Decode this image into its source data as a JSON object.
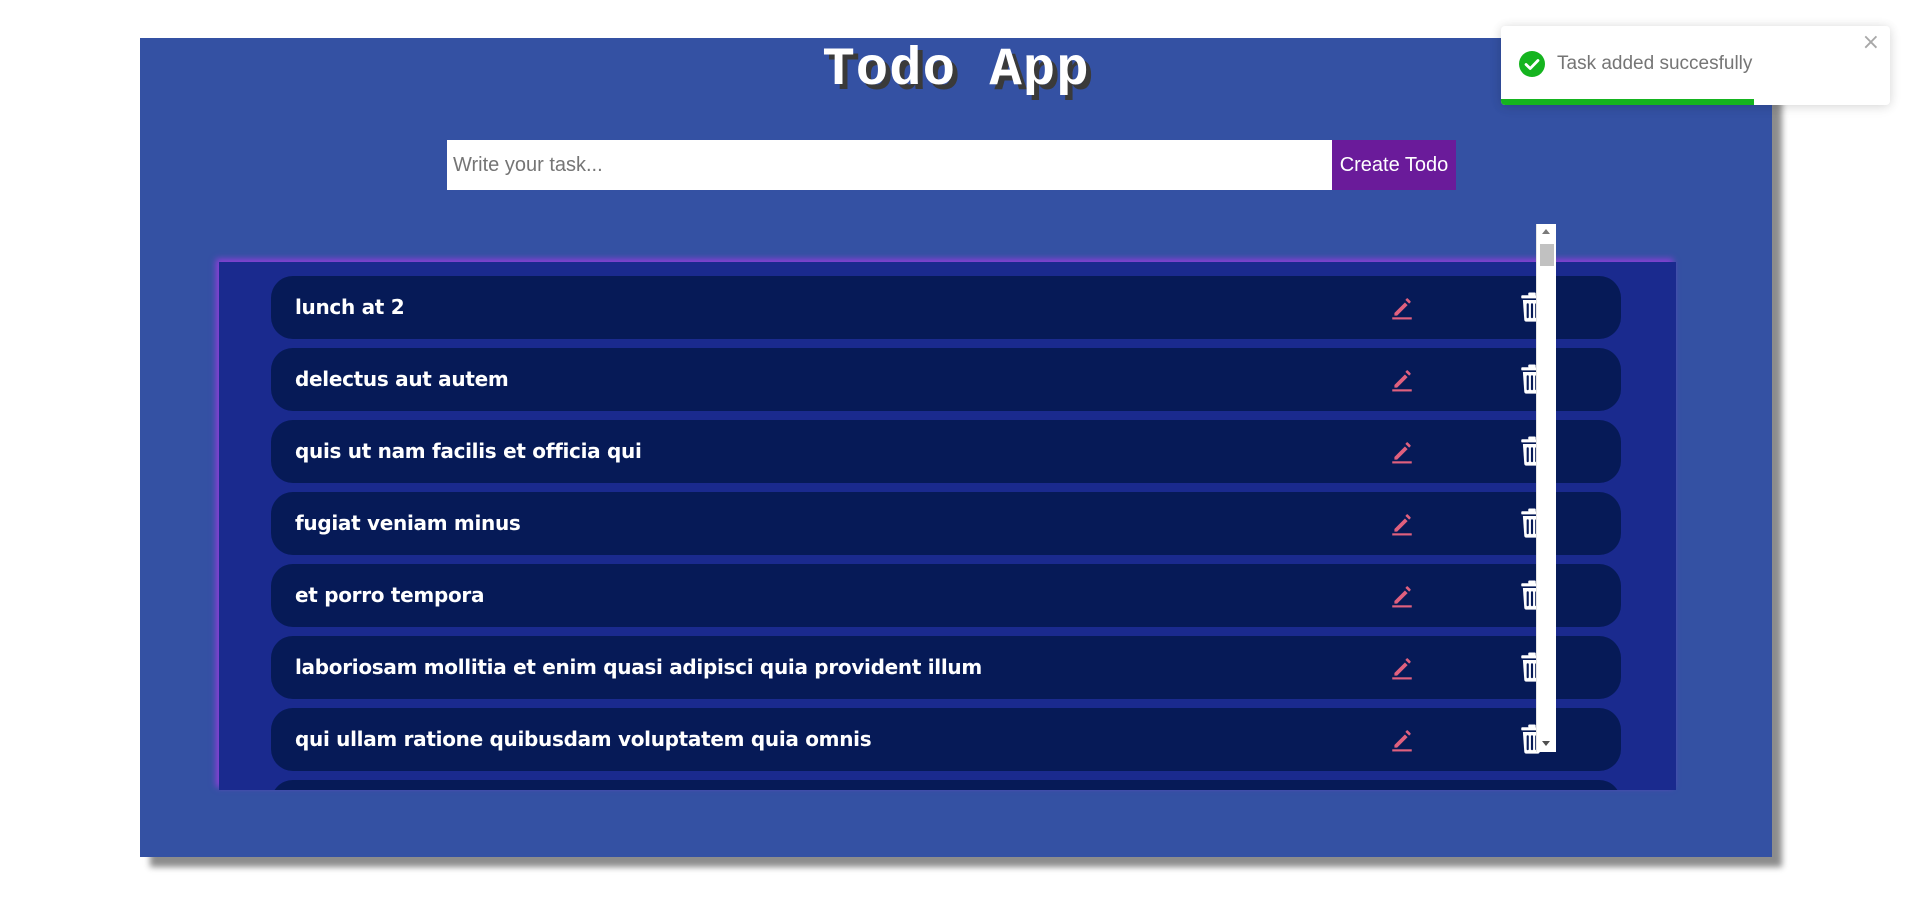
{
  "app": {
    "title": "Todo App",
    "accent_color": "#3451a3"
  },
  "form": {
    "input_value": "",
    "input_placeholder": "Write your task...",
    "create_label": "Create Todo"
  },
  "todos": [
    {
      "text": "lunch at 2"
    },
    {
      "text": "delectus aut autem"
    },
    {
      "text": "quis ut nam facilis et officia qui"
    },
    {
      "text": "fugiat veniam minus"
    },
    {
      "text": "et porro tempora"
    },
    {
      "text": "laboriosam mollitia et enim quasi adipisci quia provident illum"
    },
    {
      "text": "qui ullam ratione quibusdam voluptatem quia omnis"
    },
    {
      "text": ""
    }
  ],
  "icons": {
    "edit": "pencil-icon",
    "delete": "trash-icon",
    "toast_status": "check-circle-icon",
    "toast_close": "close-icon",
    "edit_color": "#e0607e",
    "delete_color": "#ffffff"
  },
  "toast": {
    "message": "Task added succesfully",
    "close_symbol": "×",
    "progress_fraction": 0.65,
    "progress_color": "#15b41f"
  }
}
